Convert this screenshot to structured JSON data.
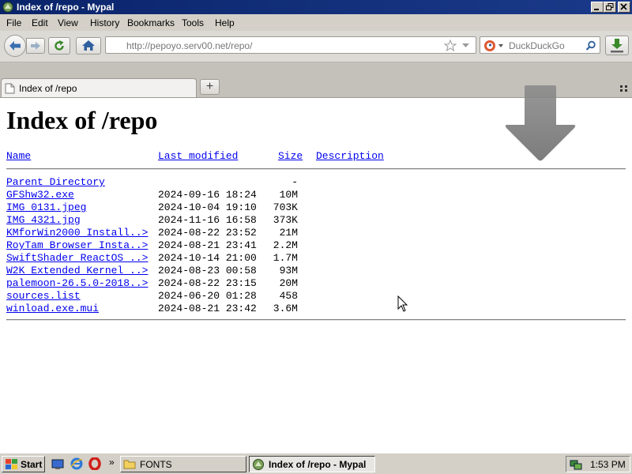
{
  "window": {
    "title": "Index of /repo - Mypal"
  },
  "menu": [
    "File",
    "Edit",
    "View",
    "History",
    "Bookmarks",
    "Tools",
    "Help"
  ],
  "nav": {
    "url": "http://pepoyo.serv00.net/repo/",
    "search_placeholder": "DuckDuckGo"
  },
  "tab": {
    "title": "Index of /repo",
    "new_tab_label": "+"
  },
  "page": {
    "heading": "Index of /repo",
    "columns": {
      "name": "Name",
      "modified": "Last modified",
      "size": "Size",
      "description": "Description"
    },
    "rows": [
      {
        "name": "Parent Directory",
        "modified": "",
        "size": "-"
      },
      {
        "name": "GFShw32.exe",
        "modified": "2024-09-16 18:24",
        "size": "10M"
      },
      {
        "name": "IMG_0131.jpeg",
        "modified": "2024-10-04 19:10",
        "size": "703K"
      },
      {
        "name": "IMG_4321.jpg",
        "modified": "2024-11-16 16:58",
        "size": "373K"
      },
      {
        "name": "KMforWin2000 Install..>",
        "modified": "2024-08-22 23:52",
        "size": "21M"
      },
      {
        "name": "RoyTam Browser Insta..>",
        "modified": "2024-08-21 23:41",
        "size": "2.2M"
      },
      {
        "name": "SwiftShader ReactOS ..>",
        "modified": "2024-10-14 21:00",
        "size": "1.7M"
      },
      {
        "name": "W2K Extended Kernel ..>",
        "modified": "2024-08-23 00:58",
        "size": "93M"
      },
      {
        "name": "palemoon-26.5.0-2018..>",
        "modified": "2024-08-22 23:15",
        "size": "20M"
      },
      {
        "name": "sources.list",
        "modified": "2024-06-20 01:28",
        "size": "458"
      },
      {
        "name": "winload.exe.mui",
        "modified": "2024-08-21 23:42",
        "size": "3.6M"
      }
    ]
  },
  "taskbar": {
    "start_label": "Start",
    "quicklaunch_more": "»",
    "items": [
      "FONTS",
      "Index of /repo - Mypal"
    ],
    "clock": "1:53 PM"
  },
  "colors": {
    "titlebar": "#0a246a",
    "link": "#0000ee",
    "desktop_gray": "#d4d0c8"
  }
}
